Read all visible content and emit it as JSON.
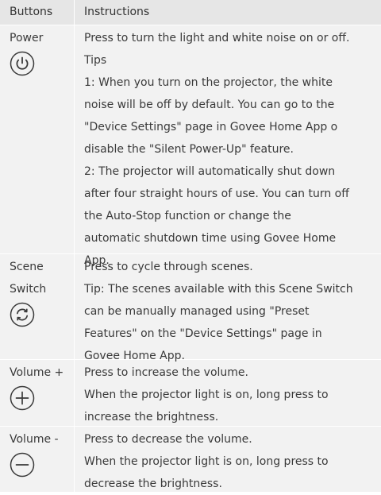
{
  "header": {
    "buttons": "Buttons",
    "instructions": "Instructions"
  },
  "rows": [
    {
      "button": [
        "Power"
      ],
      "icon": "power-icon",
      "lines": [
        "Press to turn the light and white noise on or off.",
        "Tips",
        "1: When you turn on the projector, the white",
        "noise will be off by default. You can go to the",
        "\"Device Settings\" page in Govee Home App o",
        "disable the \"Silent Power-Up\" feature.",
        "2: The projector will automatically shut down",
        "after four straight hours of use. You can turn off",
        "the Auto-Stop function or change the",
        "automatic shutdown time using Govee Home",
        "App."
      ]
    },
    {
      "button": [
        "Scene",
        "Switch"
      ],
      "icon": "scene-switch-icon",
      "lines": [
        "Press to cycle through scenes.",
        "Tip: The scenes available with this Scene Switch",
        "can be manually managed using \"Preset",
        "Features\" on the \"Device Settings\" page in",
        "Govee Home App."
      ]
    },
    {
      "button": [
        "Volume +"
      ],
      "icon": "plus-icon",
      "lines": [
        "Press to increase the volume.",
        "When the projector light is on, long press to",
        "increase the brightness."
      ]
    },
    {
      "button": [
        "Volume -"
      ],
      "icon": "minus-icon",
      "lines": [
        "Press to decrease the volume.",
        "When the projector light is on, long press to",
        "decrease the brightness."
      ]
    }
  ]
}
